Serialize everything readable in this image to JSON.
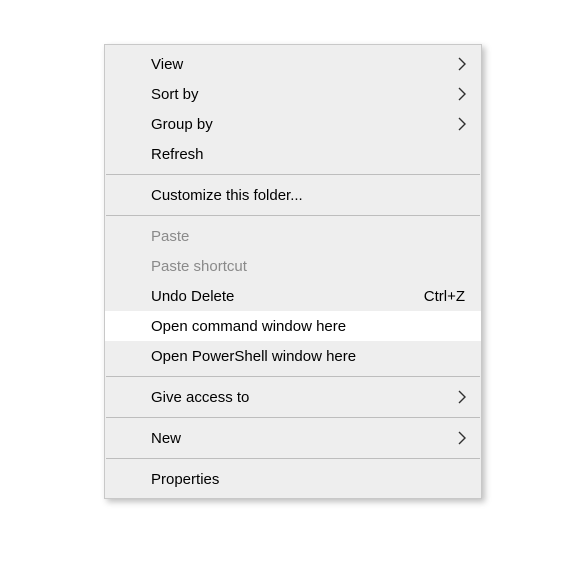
{
  "menu": {
    "items": [
      {
        "label": "View",
        "submenu": true
      },
      {
        "label": "Sort by",
        "submenu": true
      },
      {
        "label": "Group by",
        "submenu": true
      },
      {
        "label": "Refresh"
      },
      {
        "sep": true
      },
      {
        "label": "Customize this folder..."
      },
      {
        "sep": true
      },
      {
        "label": "Paste",
        "disabled": true
      },
      {
        "label": "Paste shortcut",
        "disabled": true
      },
      {
        "label": "Undo Delete",
        "shortcut": "Ctrl+Z"
      },
      {
        "label": "Open command window here",
        "hover": true
      },
      {
        "label": "Open PowerShell window here"
      },
      {
        "sep": true
      },
      {
        "label": "Give access to",
        "submenu": true
      },
      {
        "sep": true
      },
      {
        "label": "New",
        "submenu": true
      },
      {
        "sep": true
      },
      {
        "label": "Properties"
      }
    ]
  }
}
